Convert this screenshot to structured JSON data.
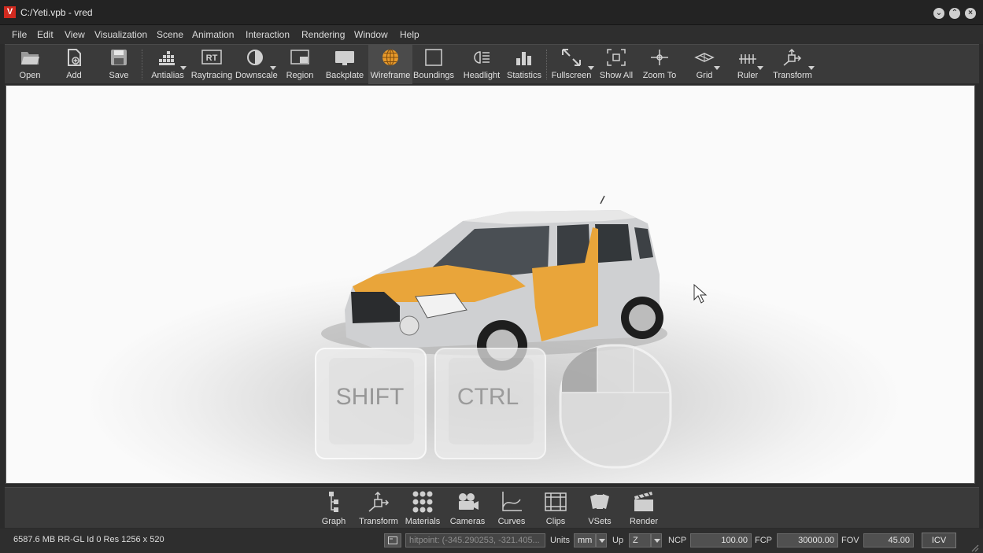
{
  "window": {
    "logo_letter": "V",
    "title": "C:/Yeti.vpb - vred",
    "controls": [
      "minimize",
      "maximize",
      "close"
    ]
  },
  "menu": [
    "File",
    "Edit",
    "View",
    "Visualization",
    "Scene",
    "Animation",
    "Interaction",
    "Rendering",
    "Window",
    "Help"
  ],
  "toolbar": {
    "open": "Open",
    "add": "Add",
    "save": "Save",
    "antialias": "Antialias",
    "raytracing": "Raytracing",
    "raytracing_badge": "RT",
    "downscale": "Downscale",
    "region": "Region",
    "backplate": "Backplate",
    "wireframe": "Wireframe",
    "boundings": "Boundings",
    "headlight": "Headlight",
    "statistics": "Statistics",
    "fullscreen": "Fullscreen",
    "show_all": "Show All",
    "zoom_to": "Zoom To",
    "grid": "Grid",
    "ruler": "Ruler",
    "transform": "Transform",
    "active_tool": "Wireframe"
  },
  "viewport": {
    "overlay_keys": {
      "shift": "SHIFT",
      "ctrl": "CTRL"
    },
    "highlight_color": "#e9a53a"
  },
  "bottom_tools": {
    "graph": "Graph",
    "transform": "Transform",
    "materials": "Materials",
    "cameras": "Cameras",
    "curves": "Curves",
    "clips": "Clips",
    "vsets": "VSets",
    "render": "Render"
  },
  "status": {
    "info": "6587.6 MB  RR-GL  Id 0 Res 1256 x 520",
    "hitpoint": "hitpoint: (-345.290253, -321.405...",
    "units_label": "Units",
    "units_value": "mm",
    "up_label": "Up",
    "up_value": "Z",
    "ncp_label": "NCP",
    "ncp_value": "100.00",
    "fcp_label": "FCP",
    "fcp_value": "30000.00",
    "fov_label": "FOV",
    "fov_value": "45.00",
    "icv_button": "ICV"
  }
}
